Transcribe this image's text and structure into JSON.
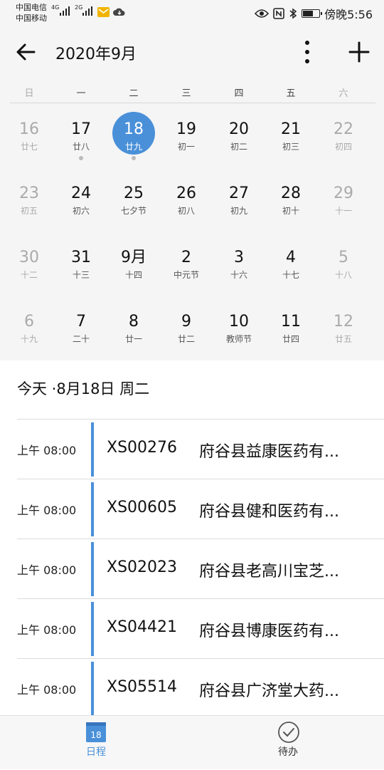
{
  "status_bar": {
    "carrier1": "中国电信",
    "carrier2": "中国移动",
    "net1": "4G",
    "net2": "2G",
    "time": "傍晚5:56",
    "icons": [
      "signal-icon",
      "mail-icon",
      "cloud-icon",
      "eye-icon",
      "nfc-icon",
      "bluetooth-icon",
      "battery-icon"
    ]
  },
  "header": {
    "title": "2020年9月",
    "back_icon": "arrow-left-icon",
    "more_icon": "more-vertical-icon",
    "add_icon": "plus-icon"
  },
  "calendar": {
    "weekdays": [
      "日",
      "一",
      "二",
      "三",
      "四",
      "五",
      "六"
    ],
    "weeks": [
      [
        {
          "day": "16",
          "lunar": "廿七",
          "dim": true
        },
        {
          "day": "17",
          "lunar": "廿八",
          "dot": true
        },
        {
          "day": "18",
          "lunar": "廿九",
          "selected": true,
          "dot": true
        },
        {
          "day": "19",
          "lunar": "初一"
        },
        {
          "day": "20",
          "lunar": "初二"
        },
        {
          "day": "21",
          "lunar": "初三"
        },
        {
          "day": "22",
          "lunar": "初四",
          "dim": true
        }
      ],
      [
        {
          "day": "23",
          "lunar": "初五",
          "dim": true
        },
        {
          "day": "24",
          "lunar": "初六"
        },
        {
          "day": "25",
          "lunar": "七夕节"
        },
        {
          "day": "26",
          "lunar": "初八"
        },
        {
          "day": "27",
          "lunar": "初九"
        },
        {
          "day": "28",
          "lunar": "初十"
        },
        {
          "day": "29",
          "lunar": "十一",
          "dim": true
        }
      ],
      [
        {
          "day": "30",
          "lunar": "十二",
          "dim": true
        },
        {
          "day": "31",
          "lunar": "十三"
        },
        {
          "day": "9月",
          "lunar": "十四"
        },
        {
          "day": "2",
          "lunar": "中元节"
        },
        {
          "day": "3",
          "lunar": "十六"
        },
        {
          "day": "4",
          "lunar": "十七"
        },
        {
          "day": "5",
          "lunar": "十八",
          "dim": true
        }
      ],
      [
        {
          "day": "6",
          "lunar": "十九",
          "dim": true
        },
        {
          "day": "7",
          "lunar": "二十"
        },
        {
          "day": "8",
          "lunar": "廿一"
        },
        {
          "day": "9",
          "lunar": "廿二"
        },
        {
          "day": "10",
          "lunar": "教师节"
        },
        {
          "day": "11",
          "lunar": "廿四"
        },
        {
          "day": "12",
          "lunar": "廿五",
          "dim": true
        }
      ]
    ]
  },
  "today_label": "今天 ·8月18日 周二",
  "schedule": [
    {
      "time": "上午 08:00",
      "code": "XS00276",
      "name": "府谷县益康医药有..."
    },
    {
      "time": "上午 08:00",
      "code": "XS00605",
      "name": "府谷县健和医药有..."
    },
    {
      "time": "上午 08:00",
      "code": "XS02023",
      "name": "府谷县老高川宝芝..."
    },
    {
      "time": "上午 08:00",
      "code": "XS04421",
      "name": "府谷县博康医药有..."
    },
    {
      "time": "上午 08:00",
      "code": "XS05514",
      "name": "府谷县广济堂大药..."
    }
  ],
  "tabs": [
    {
      "label": "日程",
      "icon": "calendar-icon",
      "badge": "18",
      "active": true
    },
    {
      "label": "待办",
      "icon": "check-circle-icon",
      "active": false
    }
  ],
  "colors": {
    "accent": "#4a90d9",
    "background": "#f5f5f5",
    "dim_text": "#aaaaaa"
  }
}
